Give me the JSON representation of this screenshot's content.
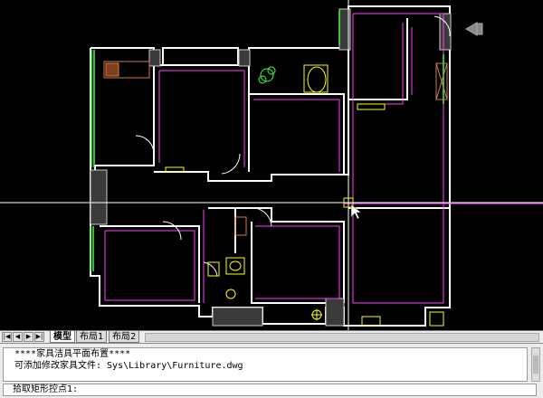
{
  "tabs": {
    "nav": [
      "|◀",
      "◀",
      "▶",
      "▶|"
    ],
    "items": [
      {
        "label": "模型",
        "active": true
      },
      {
        "label": "布局1",
        "active": false
      },
      {
        "label": "布局2",
        "active": false
      }
    ]
  },
  "command": {
    "history": [
      "****家具洁具平面布置****",
      "可添加修改家具文件: Sys\\Library\\Furniture.dwg"
    ],
    "prompt": "拾取矩形控点1:"
  },
  "colors": {
    "wall": "#ffffff",
    "door": "#ff40ff",
    "window": "#40ff40",
    "fixture": "#ffff00",
    "furniture": "#d08040",
    "crosshair": "#ffffff"
  }
}
